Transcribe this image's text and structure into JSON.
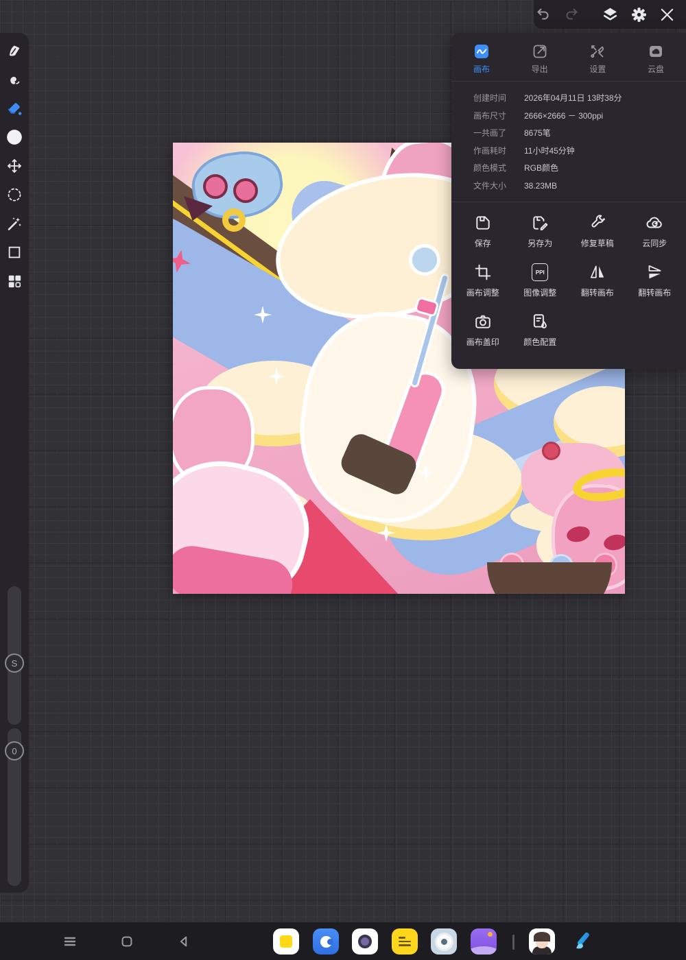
{
  "colors": {
    "accent": "#3e8ef7",
    "panel": "#29272d",
    "topbar": "#232127",
    "canvas": "#323136",
    "grid1": "#3a393f",
    "grid2": "#2c2b30",
    "strip": "#26242a",
    "bar": "#1d1c20",
    "tgray": "#98979d",
    "tlight": "#c9c8ce",
    "icon": "#e9e9ed",
    "art_pink": "#f3aec9",
    "art_pink2": "#f7c3d6",
    "art_deep": "#ee6d9a",
    "art_hot": "#e84a6e",
    "art_cream": "#fdf0d5",
    "art_yellow": "#fbe084",
    "art_pale": "#fdf6bc",
    "art_blue": "#9db7e8",
    "art_blue2": "#c6daf4",
    "art_white": "#fff7ea",
    "art_brown": "#6a4f41",
    "art_gold": "#f7d432"
  },
  "topbar": {
    "icons": [
      "undo-icon",
      "redo-icon",
      "layers-icon",
      "gear-icon",
      "close-icon"
    ]
  },
  "panel": {
    "tabs": [
      {
        "label": "画布",
        "icon": "canvas-tab-icon",
        "active": true
      },
      {
        "label": "导出",
        "icon": "export-tab-icon",
        "active": false
      },
      {
        "label": "设置",
        "icon": "settings-tab-icon",
        "active": false
      },
      {
        "label": "云盘",
        "icon": "cloud-drive-tab-icon",
        "active": false
      }
    ],
    "info": {
      "rows": [
        {
          "label": "创建时间",
          "value": "2026年04月11日 13时38分"
        },
        {
          "label": "画布尺寸",
          "value": "2666×2666 － 300ppi"
        },
        {
          "label": "一共画了",
          "value": "8675笔"
        },
        {
          "label": "作画耗时",
          "value": "11小时45分钟"
        },
        {
          "label": "颜色模式",
          "value": "RGB颜色"
        },
        {
          "label": "文件大小",
          "value": "38.23MB"
        }
      ]
    },
    "actions": [
      {
        "label": "保存",
        "icon": "save-icon"
      },
      {
        "label": "另存为",
        "icon": "save-as-icon"
      },
      {
        "label": "修复草稿",
        "icon": "repair-draft-icon"
      },
      {
        "label": "云同步",
        "icon": "cloud-sync-icon"
      },
      {
        "label": "画布调整",
        "icon": "canvas-adjust-icon"
      },
      {
        "label": "图像调整",
        "icon": "image-adjust-icon",
        "icon_text": "PPI"
      },
      {
        "label": "翻转画布",
        "icon": "flip-horizontal-icon"
      },
      {
        "label": "翻转画布",
        "icon": "flip-vertical-icon"
      },
      {
        "label": "画布盖印",
        "icon": "canvas-stamp-icon"
      },
      {
        "label": "颜色配置",
        "icon": "color-profile-icon"
      }
    ]
  },
  "left_toolbar": {
    "tools": [
      "paint-tool",
      "smudge-tool",
      "eraser-tool",
      "color-swatch",
      "move-tool",
      "lasso-tool",
      "magic-wand-tool",
      "shape-tool",
      "layers-grid-tool"
    ],
    "active_tool": "eraser-tool",
    "sliders": [
      {
        "knob_label": "S"
      },
      {
        "knob_label": "0"
      }
    ]
  },
  "taskbar": {
    "nav": [
      "menu-icon",
      "recents-icon",
      "back-icon"
    ],
    "apps": [
      "photos-app",
      "browser-app",
      "camera-app",
      "notes-app",
      "settings-app",
      "gallery-app",
      "avatar-app",
      "paintbrush-app"
    ]
  }
}
